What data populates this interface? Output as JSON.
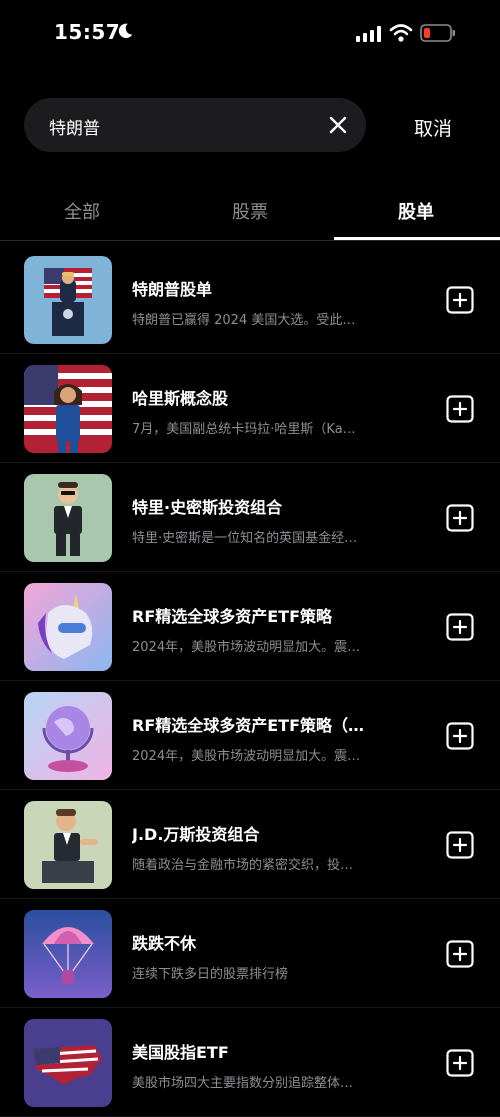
{
  "status_bar": {
    "time": "15:57"
  },
  "search": {
    "query": "特朗普",
    "cancel_label": "取消"
  },
  "tabs": [
    {
      "label": "全部"
    },
    {
      "label": "股票"
    },
    {
      "label": "股单",
      "active": true
    }
  ],
  "items": [
    {
      "title": "特朗普股单",
      "desc": "特朗普已赢得 2024 美国大选。受此…",
      "thumb": "podium-speaker-image"
    },
    {
      "title": "哈里斯概念股",
      "desc": "7月，美国副总统卡玛拉·哈里斯（Ka…",
      "thumb": "flag-figure-image"
    },
    {
      "title": "特里·史密斯投资组合",
      "desc": "特里·史密斯是一位知名的英国基金经…",
      "thumb": "suited-figure-image"
    },
    {
      "title": "RF精选全球多资产ETF策略",
      "desc": "2024年，美股市场波动明显加大。震…",
      "thumb": "unicorn-image"
    },
    {
      "title": "RF精选全球多资产ETF策略（…",
      "desc": "2024年，美股市场波动明显加大。震…",
      "thumb": "globe-image"
    },
    {
      "title": "J.D.万斯投资组合",
      "desc": "随着政治与金融市场的紧密交织，投…",
      "thumb": "speaker-figure-image"
    },
    {
      "title": "跌跌不休",
      "desc": "连续下跌多日的股票排行榜",
      "thumb": "parachute-image"
    },
    {
      "title": "美国股指ETF",
      "desc": "美股市场四大主要指数分别追踪整体…",
      "thumb": "us-map-image"
    }
  ],
  "colors": {
    "background": "#000000",
    "muted_text": "#8e8e93",
    "search_bg": "#1c1c1e",
    "battery_low": "#ff3b30"
  }
}
